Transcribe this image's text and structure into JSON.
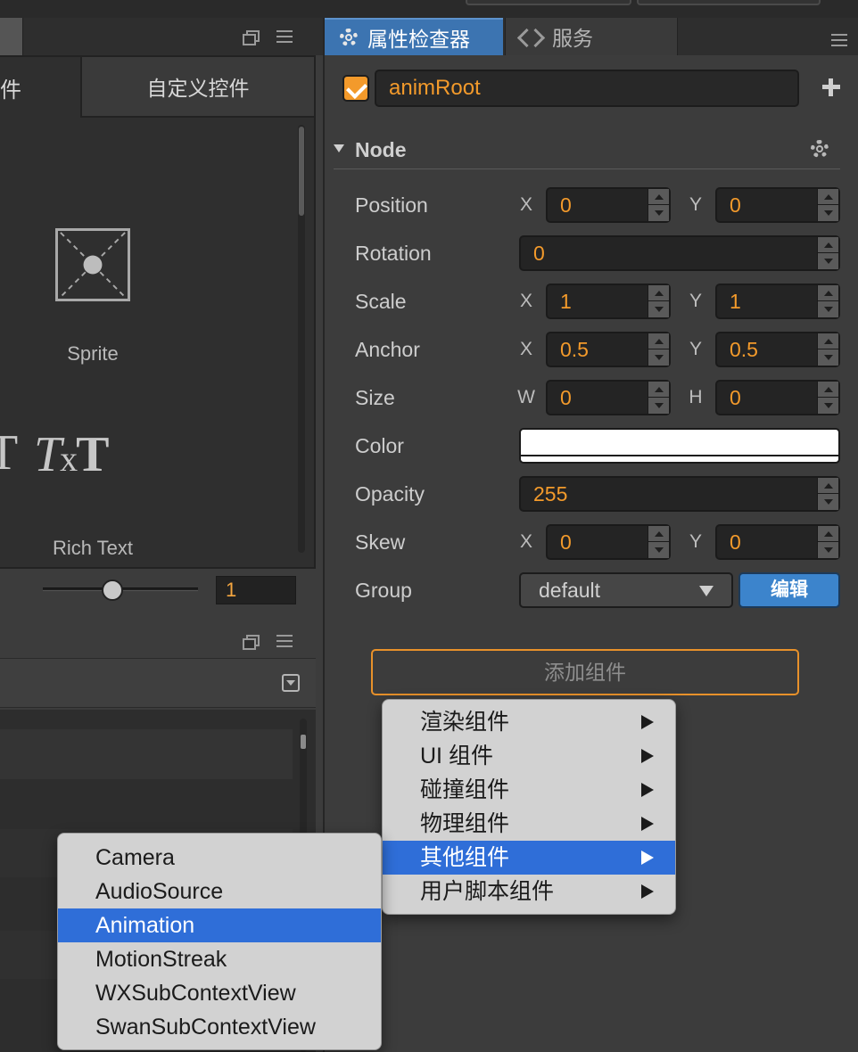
{
  "left_panel": {
    "partial_tab_label": "件",
    "custom_controls_tab": "自定义控件",
    "assets": [
      {
        "label": "Sprite"
      },
      {
        "label": "Rich Text",
        "icon_text_a": "T",
        "icon_text_b": "x",
        "icon_text_c": "T"
      }
    ],
    "partial_icon_glyph": "T",
    "partial_label": "",
    "zoom_value": "1"
  },
  "inspector": {
    "tabs": [
      {
        "label": "属性检查器",
        "icon": "gear-icon",
        "active": true
      },
      {
        "label": "服务",
        "icon": "service-icon",
        "active": false
      }
    ],
    "node_name": "animRoot",
    "node_enabled": true,
    "section_title": "Node",
    "properties": {
      "position": {
        "label": "Position",
        "x_axis": "X",
        "x": "0",
        "y_axis": "Y",
        "y": "0"
      },
      "rotation": {
        "label": "Rotation",
        "value": "0"
      },
      "scale": {
        "label": "Scale",
        "x_axis": "X",
        "x": "1",
        "y_axis": "Y",
        "y": "1"
      },
      "anchor": {
        "label": "Anchor",
        "x_axis": "X",
        "x": "0.5",
        "y_axis": "Y",
        "y": "0.5"
      },
      "size": {
        "label": "Size",
        "w_axis": "W",
        "w": "0",
        "h_axis": "H",
        "h": "0"
      },
      "color": {
        "label": "Color",
        "value": "#ffffff"
      },
      "opacity": {
        "label": "Opacity",
        "value": "255"
      },
      "skew": {
        "label": "Skew",
        "x_axis": "X",
        "x": "0",
        "y_axis": "Y",
        "y": "0"
      },
      "group": {
        "label": "Group",
        "value": "default",
        "edit_label": "编辑"
      }
    },
    "add_component_label": "添加组件"
  },
  "add_component_menu": {
    "items": [
      {
        "label": "渲染组件",
        "active": false
      },
      {
        "label": "UI 组件",
        "active": false
      },
      {
        "label": "碰撞组件",
        "active": false
      },
      {
        "label": "物理组件",
        "active": false
      },
      {
        "label": "其他组件",
        "active": true
      },
      {
        "label": "用户脚本组件",
        "active": false
      }
    ]
  },
  "other_components_submenu": {
    "items": [
      {
        "label": "Camera",
        "active": false
      },
      {
        "label": "AudioSource",
        "active": false
      },
      {
        "label": "Animation",
        "active": true
      },
      {
        "label": "MotionStreak",
        "active": false
      },
      {
        "label": "WXSubContextView",
        "active": false
      },
      {
        "label": "SwanSubContextView",
        "active": false
      }
    ]
  },
  "colors": {
    "accent_orange": "#f39a2b",
    "active_tab_blue": "#3c74b1",
    "menu_highlight": "#2f6ed8",
    "edit_button": "#3c84cc"
  }
}
